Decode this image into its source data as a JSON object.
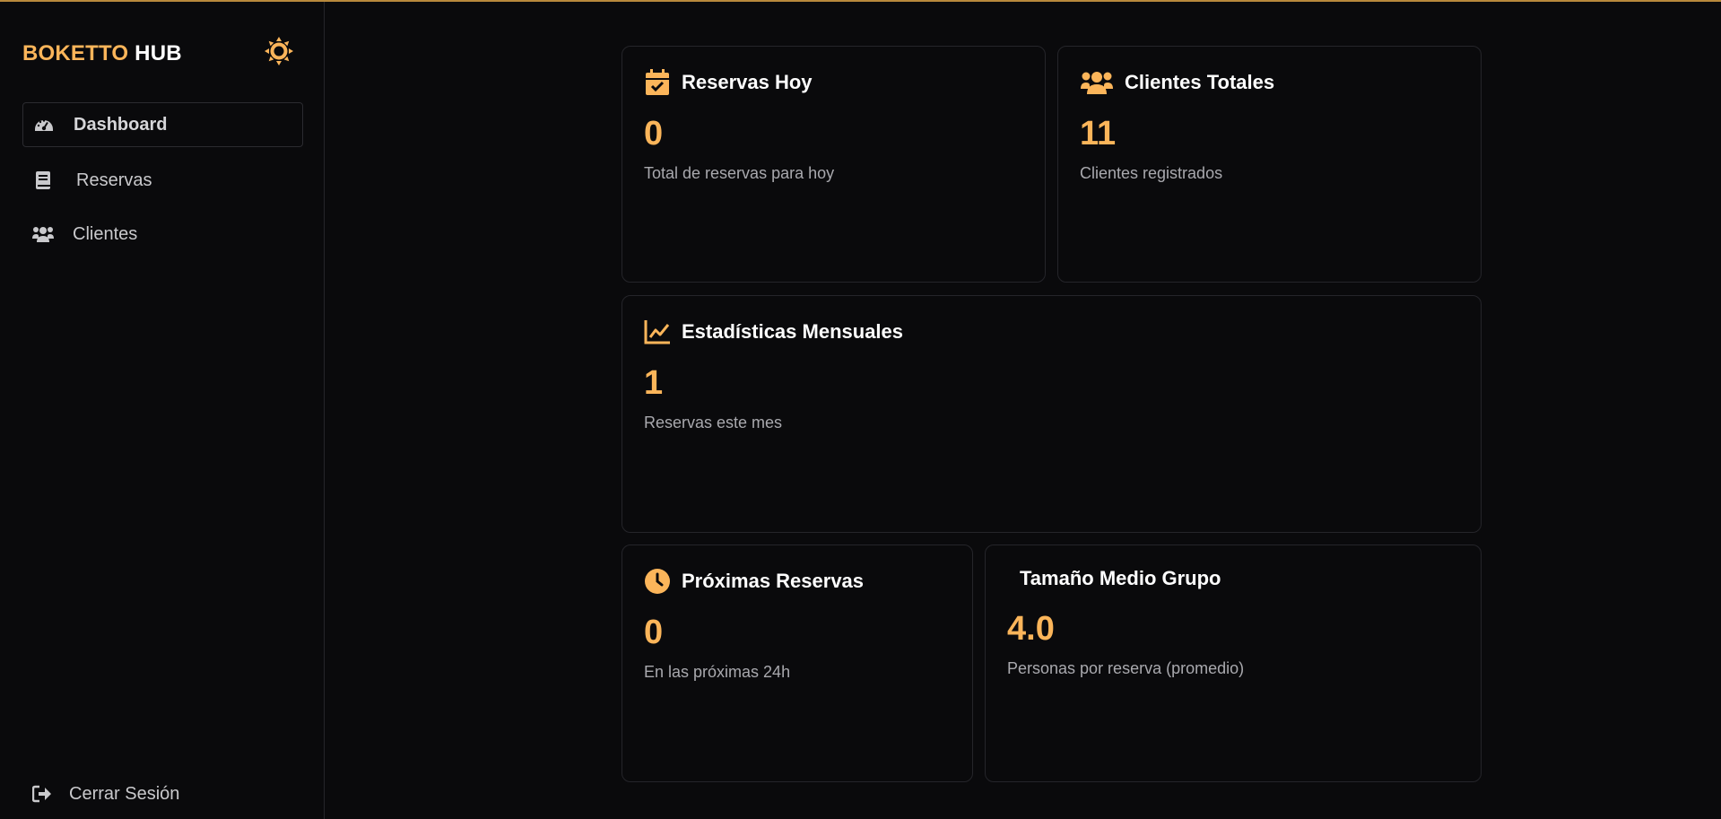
{
  "app": {
    "brand_accent": "BOKETTO",
    "brand_rest": "HUB"
  },
  "colors": {
    "accent": "#fbb55a",
    "background": "#0a0a0c",
    "border": "#25252a",
    "muted_text": "#a9a9ae"
  },
  "sidebar": {
    "theme_icon": "sun-icon",
    "items": [
      {
        "label": "Dashboard",
        "icon": "gauge-icon",
        "active": true
      },
      {
        "label": "Reservas",
        "icon": "book-icon",
        "active": false
      },
      {
        "label": "Clientes",
        "icon": "users-icon",
        "active": false
      }
    ],
    "logout_label": "Cerrar Sesión",
    "logout_icon": "sign-out-icon"
  },
  "cards": {
    "reservas_hoy": {
      "title": "Reservas Hoy",
      "value": "0",
      "subtitle": "Total de reservas para hoy",
      "icon": "calendar-check-icon"
    },
    "clientes_totales": {
      "title": "Clientes Totales",
      "value": "11",
      "subtitle": "Clientes registrados",
      "icon": "users-icon"
    },
    "estadisticas": {
      "title": "Estadísticas Mensuales",
      "value": "1",
      "subtitle": "Reservas este mes",
      "icon": "chart-line-icon"
    },
    "proximas": {
      "title": "Próximas Reservas",
      "value": "0",
      "subtitle": "En las próximas 24h",
      "icon": "clock-icon"
    },
    "tamano": {
      "title": "Tamaño Medio Grupo",
      "value": "4.0",
      "subtitle": "Personas por reserva (promedio)"
    }
  }
}
